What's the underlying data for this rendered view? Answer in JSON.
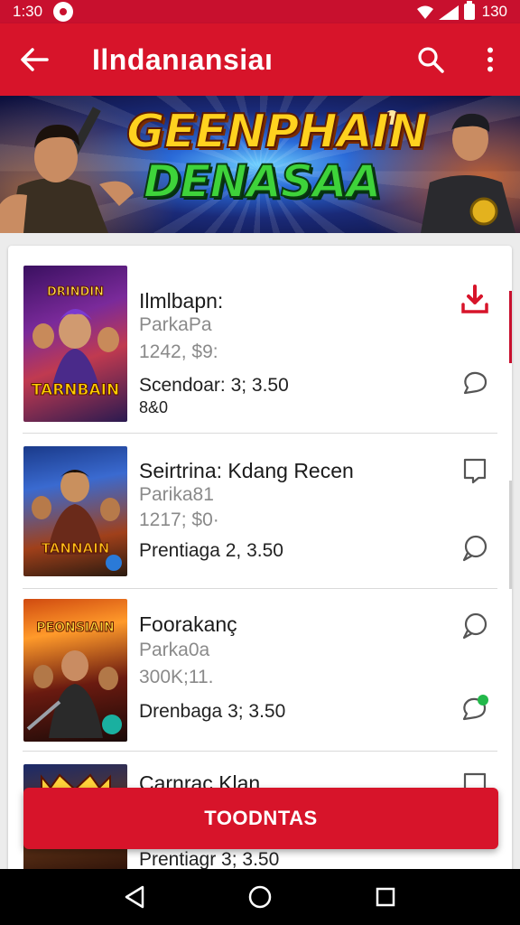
{
  "status": {
    "time": "1:30",
    "battery_text": "130"
  },
  "app_bar": {
    "title": "Ilndanıansiaı",
    "back_icon": "arrow-left-icon",
    "search_icon": "search-icon",
    "menu_icon": "more-vert-icon"
  },
  "banner": {
    "line1": "GEENPHAIN",
    "line2": "DENASAA"
  },
  "items": [
    {
      "title": "Ilmlbapn:",
      "subtitle": "ParkaPa",
      "count": "1242, $9:",
      "price": "Scendoar: 3; 3.50",
      "extra": "8&0",
      "thumb_text": "TARNBAIN",
      "thumb_top_text": "DRINDIN",
      "icon_top": "download-icon",
      "icon_bottom": "chat-icon"
    },
    {
      "title": "Seirtrina: Kdang Recen",
      "subtitle": "Parika81",
      "count": "1217; $0·",
      "price": "Prentiaga 2, 3.50",
      "thumb_text": "TANNAIN",
      "icon_top": "bookmark-icon",
      "icon_bottom": "chat-icon"
    },
    {
      "title": "Foorakanç",
      "subtitle": "Parka0a",
      "count": "300K;11.",
      "price": "Drenbaga 3; 3.50",
      "thumb_text": "PEONSIAIN",
      "icon_top": "chat-icon",
      "icon_bottom": "chat-new-icon"
    },
    {
      "title": "Carnrac Klan",
      "price": "Prentiagr 3; 3.50",
      "icon_top": "bookmark-icon"
    }
  ],
  "fab": {
    "label": "TOODNTAS"
  },
  "colors": {
    "primary": "#d7142a",
    "status": "#c8102e"
  }
}
